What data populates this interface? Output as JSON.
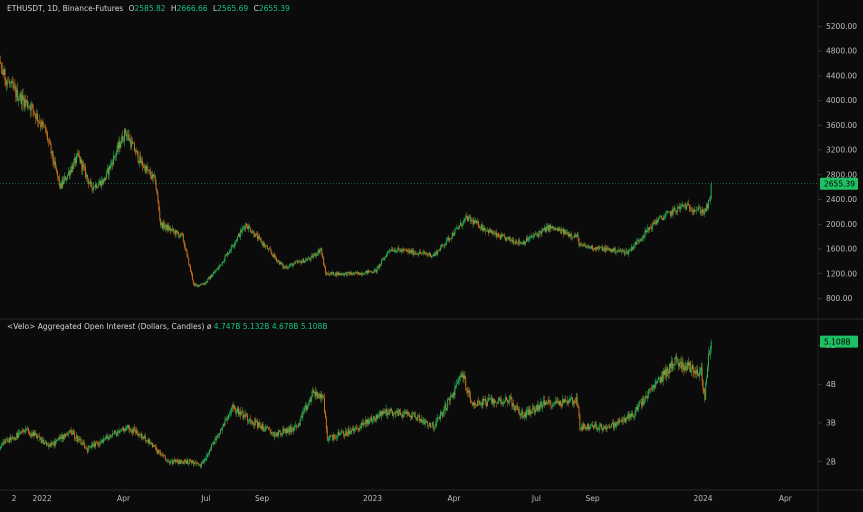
{
  "colors": {
    "up": "#1fbf63",
    "down": "#d9791f",
    "background": "#0b0b0b",
    "last_price_bg": "#1fbf63",
    "grid": "#1e1e1e"
  },
  "header": {
    "symbol": "ETHUSDT, 1D, Binance-Futures",
    "o_label": "O",
    "o_value": "2585.82",
    "h_label": "H",
    "h_value": "2666.66",
    "l_label": "L",
    "l_value": "2565.69",
    "c_label": "C",
    "c_value": "2655.39"
  },
  "indicator": {
    "title": "<Velo> Aggregated Open Interest (Dollars, Candles)",
    "symbol": "ø",
    "o_value": "4.747B",
    "h_value": "5.132B",
    "l_value": "4.678B",
    "c_value": "5.108B"
  },
  "chart_data": [
    {
      "type": "candlestick",
      "title": "ETHUSDT, 1D, Binance-Futures",
      "y_ticks": [
        "5200.00",
        "4800.00",
        "4400.00",
        "4000.00",
        "3600.00",
        "3200.00",
        "2800.00",
        "2400.00",
        "2000.00",
        "1600.00",
        "1200.00",
        "800.00"
      ],
      "ylim": [
        500,
        5400
      ],
      "last_value": "2655.39",
      "anchors": [
        {
          "x": "2021-11-01",
          "y": 3000
        },
        {
          "x": "2021-11-06",
          "y": 4300
        },
        {
          "x": "2021-11-10",
          "y": 4700
        },
        {
          "x": "2021-11-24",
          "y": 4300
        },
        {
          "x": "2021-12-04",
          "y": 4100
        },
        {
          "x": "2021-12-20",
          "y": 3900
        },
        {
          "x": "2022-01-05",
          "y": 3500
        },
        {
          "x": "2022-01-21",
          "y": 2600
        },
        {
          "x": "2022-02-10",
          "y": 3100
        },
        {
          "x": "2022-02-24",
          "y": 2600
        },
        {
          "x": "2022-03-10",
          "y": 2700
        },
        {
          "x": "2022-04-03",
          "y": 3500
        },
        {
          "x": "2022-04-20",
          "y": 3000
        },
        {
          "x": "2022-05-06",
          "y": 2700
        },
        {
          "x": "2022-05-12",
          "y": 2000
        },
        {
          "x": "2022-06-05",
          "y": 1800
        },
        {
          "x": "2022-06-18",
          "y": 1000
        },
        {
          "x": "2022-06-30",
          "y": 1050
        },
        {
          "x": "2022-07-15",
          "y": 1300
        },
        {
          "x": "2022-08-14",
          "y": 2000
        },
        {
          "x": "2022-09-07",
          "y": 1600
        },
        {
          "x": "2022-09-25",
          "y": 1300
        },
        {
          "x": "2022-10-25",
          "y": 1450
        },
        {
          "x": "2022-11-05",
          "y": 1600
        },
        {
          "x": "2022-11-10",
          "y": 1200
        },
        {
          "x": "2022-12-15",
          "y": 1200
        },
        {
          "x": "2023-01-05",
          "y": 1250
        },
        {
          "x": "2023-01-20",
          "y": 1600
        },
        {
          "x": "2023-03-10",
          "y": 1500
        },
        {
          "x": "2023-04-15",
          "y": 2100
        },
        {
          "x": "2023-05-20",
          "y": 1800
        },
        {
          "x": "2023-06-15",
          "y": 1700
        },
        {
          "x": "2023-07-15",
          "y": 1950
        },
        {
          "x": "2023-08-15",
          "y": 1800
        },
        {
          "x": "2023-08-18",
          "y": 1650
        },
        {
          "x": "2023-10-10",
          "y": 1550
        },
        {
          "x": "2023-11-10",
          "y": 2050
        },
        {
          "x": "2023-12-10",
          "y": 2300
        },
        {
          "x": "2024-01-03",
          "y": 2200
        },
        {
          "x": "2024-01-09",
          "y": 2400
        },
        {
          "x": "2024-01-10",
          "y": 2655
        }
      ]
    },
    {
      "type": "candlestick",
      "title": "<Velo> Aggregated Open Interest (Dollars, Candles)",
      "y_ticks": [
        "5B",
        "4B",
        "3B",
        "2B"
      ],
      "ylim": [
        1.45,
        5.4
      ],
      "last_value": "5.108B",
      "anchors": [
        {
          "x": "2021-11-01",
          "y": 1.75
        },
        {
          "x": "2021-11-20",
          "y": 2.5
        },
        {
          "x": "2021-12-15",
          "y": 2.8
        },
        {
          "x": "2022-01-10",
          "y": 2.4
        },
        {
          "x": "2022-02-01",
          "y": 2.8
        },
        {
          "x": "2022-02-20",
          "y": 2.3
        },
        {
          "x": "2022-03-05",
          "y": 2.5
        },
        {
          "x": "2022-04-05",
          "y": 2.9
        },
        {
          "x": "2022-04-25",
          "y": 2.6
        },
        {
          "x": "2022-05-20",
          "y": 2.0
        },
        {
          "x": "2022-06-15",
          "y": 2.0
        },
        {
          "x": "2022-06-25",
          "y": 1.9
        },
        {
          "x": "2022-07-05",
          "y": 2.3
        },
        {
          "x": "2022-07-30",
          "y": 3.4
        },
        {
          "x": "2022-08-25",
          "y": 3.0
        },
        {
          "x": "2022-09-15",
          "y": 2.7
        },
        {
          "x": "2022-10-10",
          "y": 2.9
        },
        {
          "x": "2022-10-28",
          "y": 3.8
        },
        {
          "x": "2022-11-08",
          "y": 3.6
        },
        {
          "x": "2022-11-12",
          "y": 2.6
        },
        {
          "x": "2022-12-10",
          "y": 2.8
        },
        {
          "x": "2023-01-15",
          "y": 3.3
        },
        {
          "x": "2023-02-15",
          "y": 3.2
        },
        {
          "x": "2023-03-10",
          "y": 2.9
        },
        {
          "x": "2023-04-01",
          "y": 3.8
        },
        {
          "x": "2023-04-10",
          "y": 4.3
        },
        {
          "x": "2023-04-20",
          "y": 3.5
        },
        {
          "x": "2023-06-01",
          "y": 3.6
        },
        {
          "x": "2023-06-15",
          "y": 3.2
        },
        {
          "x": "2023-07-10",
          "y": 3.5
        },
        {
          "x": "2023-08-15",
          "y": 3.6
        },
        {
          "x": "2023-08-18",
          "y": 2.9
        },
        {
          "x": "2023-09-20",
          "y": 2.9
        },
        {
          "x": "2023-10-15",
          "y": 3.2
        },
        {
          "x": "2023-11-10",
          "y": 4.0
        },
        {
          "x": "2023-12-01",
          "y": 4.6
        },
        {
          "x": "2023-12-30",
          "y": 4.3
        },
        {
          "x": "2024-01-03",
          "y": 3.7
        },
        {
          "x": "2024-01-06",
          "y": 4.5
        },
        {
          "x": "2024-01-10",
          "y": 5.1
        }
      ]
    }
  ],
  "x_axis": {
    "labels": [
      {
        "text": "2",
        "date": "2021-12-01"
      },
      {
        "text": "2022",
        "date": "2022-01-01"
      },
      {
        "text": "Apr",
        "date": "2022-04-01"
      },
      {
        "text": "Jul",
        "date": "2022-07-01"
      },
      {
        "text": "Sep",
        "date": "2022-09-01"
      },
      {
        "text": "2023",
        "date": "2023-01-01"
      },
      {
        "text": "Apr",
        "date": "2023-04-01"
      },
      {
        "text": "Jul",
        "date": "2023-07-01"
      },
      {
        "text": "Sep",
        "date": "2023-09-01"
      },
      {
        "text": "2024",
        "date": "2024-01-01"
      },
      {
        "text": "Apr",
        "date": "2024-04-01"
      }
    ]
  }
}
